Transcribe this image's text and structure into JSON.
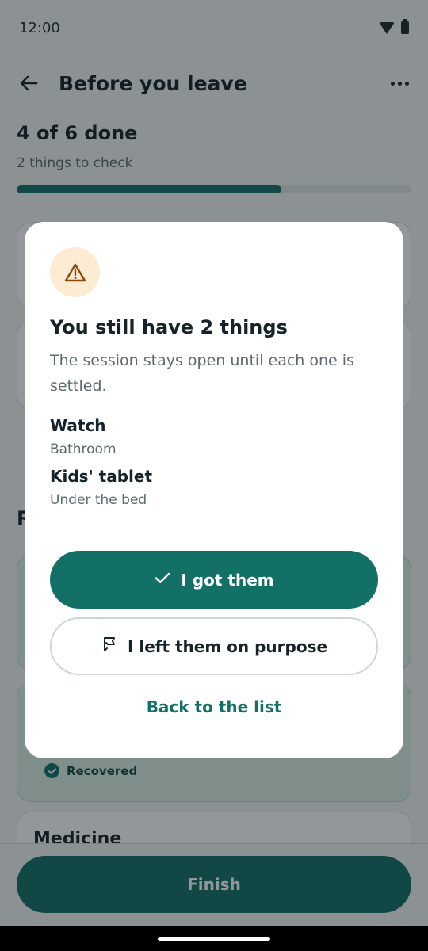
{
  "status_bar": {
    "time": "12:00",
    "icons": [
      "wifi-icon",
      "battery-icon"
    ]
  },
  "app_bar": {
    "title": "Before you leave",
    "back_icon": "arrow-left-icon",
    "menu_icon": "more-horizontal-icon"
  },
  "progress": {
    "title": "4 of 6 done",
    "subtitle": "2 things to check",
    "completed": 4,
    "total": 6,
    "fill_fraction": 0.67
  },
  "background": {
    "section_initial": "R",
    "recovered_label": "Recovered",
    "partial_item": "Medicine",
    "finish_label": "Finish"
  },
  "dialog": {
    "icon": "warning-icon",
    "title": "You still have 2 things",
    "body": "The session stays open until each one is settled.",
    "items": [
      {
        "name": "Watch",
        "location": "Bathroom"
      },
      {
        "name": "Kids' tablet",
        "location": "Under the bed"
      }
    ],
    "primary_label": "I got them",
    "primary_icon": "check-icon",
    "secondary_label": "I left them on purpose",
    "secondary_icon": "flag-bookmark-icon",
    "tertiary_label": "Back to the list"
  },
  "colors": {
    "accent": "#137066",
    "warning_bg": "#fdebd3",
    "warning_fg": "#8a4b08",
    "text": "#16232a",
    "muted": "#5d6a70"
  }
}
